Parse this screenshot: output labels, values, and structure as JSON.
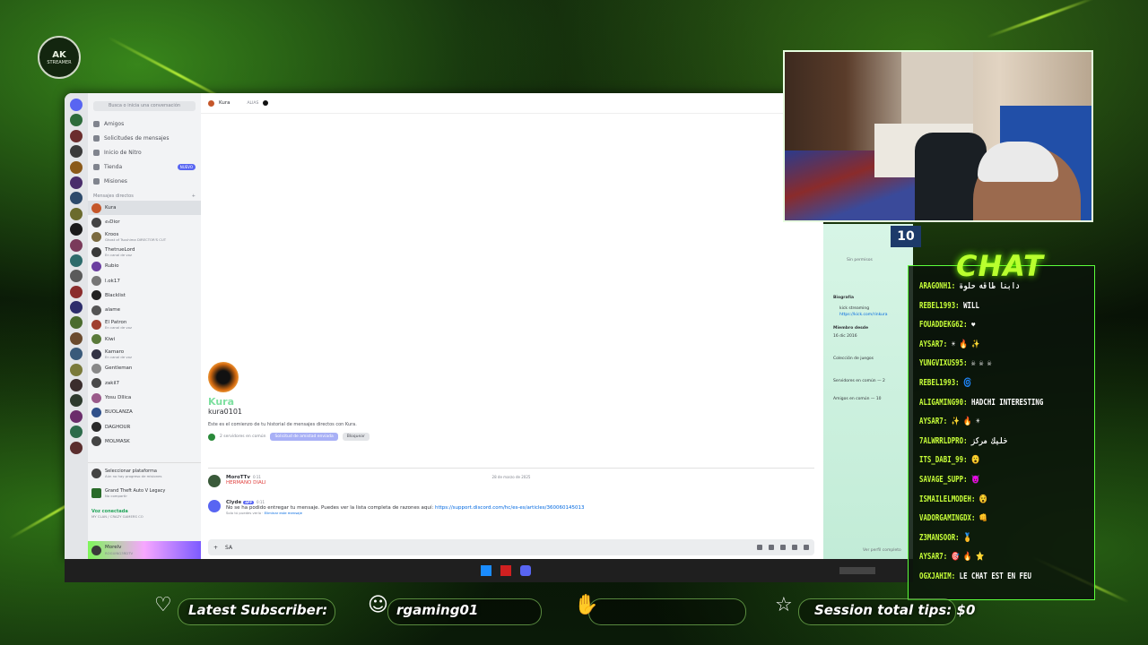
{
  "overlay": {
    "logo_text": "AK",
    "logo_sub": "STREAMER",
    "chat_title": "CHAT",
    "bottom": {
      "latest_subscriber_label": "Latest Subscriber:",
      "latest_subscriber_value": "rgaming01",
      "session_tips": "Session total tips: $0"
    },
    "webcam_score": "10"
  },
  "discord": {
    "search_placeholder": "Busca o inicia una conversación",
    "nav": [
      {
        "label": "Amigos",
        "icon": "friends-icon"
      },
      {
        "label": "Solicitudes de mensajes",
        "icon": "mail-icon"
      },
      {
        "label": "Inicio de Nitro",
        "icon": "nitro-icon"
      },
      {
        "label": "Tienda",
        "icon": "shop-icon",
        "badge": "NUEVO"
      },
      {
        "label": "Misiones",
        "icon": "quest-icon"
      }
    ],
    "dm_header": "Mensajes directos",
    "dm_add": "+",
    "dms": [
      {
        "name": "Kura",
        "sub": "",
        "selected": true,
        "color": "#c5572a"
      },
      {
        "name": "ꫀ𝓇Dior",
        "sub": "",
        "color": "#444"
      },
      {
        "name": "Kroos",
        "sub": "Ghost of Tsushima DIRECTOR'S CUT",
        "color": "#7a6a40"
      },
      {
        "name": "ThetrueLord",
        "sub": "En canal de voz",
        "color": "#3a3a3a"
      },
      {
        "name": "Rubio",
        "sub": "",
        "color": "#6b3fa0"
      },
      {
        "name": "l.ok17",
        "sub": "",
        "color": "#777"
      },
      {
        "name": "Blacklist",
        "sub": "",
        "color": "#222"
      },
      {
        "name": "alame",
        "sub": "",
        "color": "#555"
      },
      {
        "name": "El Patron",
        "sub": "En canal de voz",
        "color": "#a04030"
      },
      {
        "name": "Kiwi",
        "sub": "",
        "color": "#5a7a3a"
      },
      {
        "name": "Kamaro",
        "sub": "En canal de voz",
        "color": "#334"
      },
      {
        "name": "Gentleman",
        "sub": "",
        "color": "#888"
      },
      {
        "name": "zakil7",
        "sub": "",
        "color": "#4a4a4a"
      },
      {
        "name": "Yosu Dllica",
        "sub": "",
        "color": "#9a5a8a"
      },
      {
        "name": "BUOLANZA",
        "sub": "",
        "color": "#30508a"
      },
      {
        "name": "DAGHOUR",
        "sub": "",
        "color": "#2a2a2a"
      },
      {
        "name": "MOLMASK",
        "sub": "",
        "color": "#444"
      }
    ],
    "platform": {
      "title": "Seleccionar plataforma",
      "sub": "Aún no hay progreso de misiones"
    },
    "game": {
      "title": "Grand Theft Auto V Legacy",
      "sub": "No compartir"
    },
    "voice": {
      "status": "Voz conectada",
      "channel": "MY CLAN / CRAZY GAMERS CO"
    },
    "user": {
      "name": "Morelv",
      "sub": "ROGUING3RDTV"
    },
    "chat_header": {
      "name": "Kura",
      "alias": "ALIAS"
    },
    "intro": {
      "display_name": "Kura",
      "username": "kura0101",
      "text": "Este es el comienzo de tu historial de mensajes directos con Kura.",
      "mutual": "2 servidores en común",
      "request_btn": "Solicitud de amistad enviada",
      "block_btn": "Bloquear"
    },
    "date_separator": "28 de marzo de 2025",
    "messages": [
      {
        "author": "MoroTTv",
        "tag": "",
        "time": "0:11",
        "text": "HERMANO DIALI",
        "red": true
      },
      {
        "author": "Clyde",
        "tag": "APP",
        "time": "0:11",
        "text": "No se ha podido entregar tu mensaje. Puedes ver la lista completa de razones aquí: ",
        "link": "https://support.discord.com/hc/es-es/articles/360060145013",
        "note": "Solo tú puedes verlo · ",
        "note_link": "Eliminar este mensaje"
      }
    ],
    "input_value": "SA"
  },
  "profile": {
    "status": "Sin permisos",
    "bio_label": "Biografía",
    "bio_line1": "kick streaming",
    "bio_link": "https://kick.com/rinkura",
    "member_since_label": "Miembro desde",
    "member_since": "16 dic 2016",
    "games_label": "Colección de juegos",
    "mutual_servers": "Servidores en común — 2",
    "mutual_friends": "Amigos en común — 10",
    "view_profile": "Ver perfil completo"
  },
  "chat": [
    {
      "user": "ARAGONH1:",
      "msg": "دابنا طاقه حلوة"
    },
    {
      "user": "REBEL1993:",
      "msg": "WILL"
    },
    {
      "user": "FOUADDEKG62:",
      "msg": "❤"
    },
    {
      "user": "AYSAR7:",
      "msg": "☀ 🔥 ✨"
    },
    {
      "user": "YUNGVIXUS95:",
      "msg": "☠ ☠ ☠"
    },
    {
      "user": "REBEL1993:",
      "msg": "🌀"
    },
    {
      "user": "ALIGAMING90:",
      "msg": "HADCHI INTERESTING"
    },
    {
      "user": "AYSAR7:",
      "msg": "✨ 🔥 ☀"
    },
    {
      "user": "7ALWRRLDPRO:",
      "msg": "خليك مركز"
    },
    {
      "user": "ITS_DABI_99:",
      "msg": "😮"
    },
    {
      "user": "SAVAGE_SUPP:",
      "msg": "😈"
    },
    {
      "user": "ISMAILELMODEH:",
      "msg": "😵"
    },
    {
      "user": "VADORGAMINGDX:",
      "msg": "👊"
    },
    {
      "user": "Z3MANSOOR:",
      "msg": "🥇"
    },
    {
      "user": "AYSAR7:",
      "msg": "🎯 🔥 ⭐"
    },
    {
      "user": "OGXJAHIM:",
      "msg": "LE CHAT EST EN FEU"
    }
  ],
  "colors": {
    "accent": "#b9ff2e",
    "discord_blurple": "#5865f2",
    "link": "#0068e0"
  }
}
